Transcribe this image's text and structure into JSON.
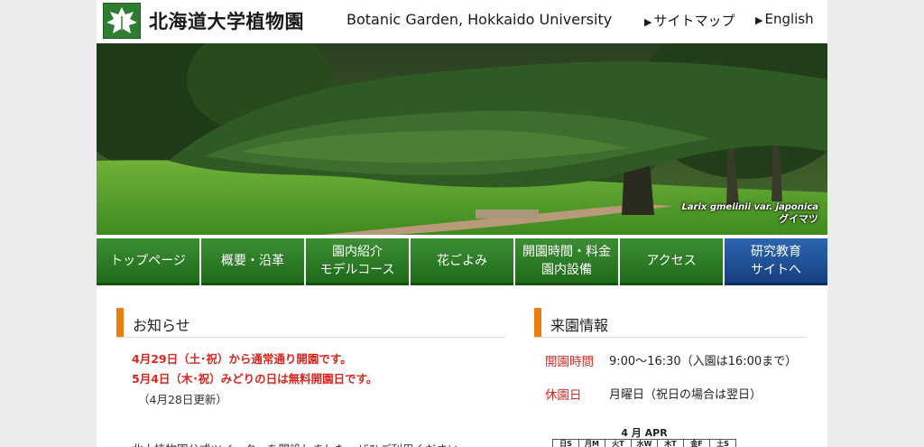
{
  "header": {
    "logo_icon": "leaf-logo-icon",
    "title_ja": "北海道大学植物園",
    "title_en": "Botanic Garden, Hokkaido University",
    "links": [
      {
        "label": "サイトマップ",
        "icon": "triangle-right-icon"
      },
      {
        "label": "English",
        "icon": "triangle-right-icon"
      }
    ]
  },
  "hero": {
    "caption_latin": "Larix gmelinii var. japonica",
    "caption_ja": "グイマツ"
  },
  "nav": [
    {
      "line1": "トップページ",
      "line2": ""
    },
    {
      "line1": "概要・沿革",
      "line2": ""
    },
    {
      "line1": "園内紹介",
      "line2": "モデルコース"
    },
    {
      "line1": "花ごよみ",
      "line2": ""
    },
    {
      "line1": "開園時間・料金",
      "line2": "園内設備"
    },
    {
      "line1": "アクセス",
      "line2": ""
    },
    {
      "line1": "研究教育",
      "line2": "サイトへ"
    }
  ],
  "news": {
    "title": "お知らせ",
    "items": [
      "4月29日（土･祝）から通常通り開園です。",
      "5月4日（木･祝）みどりの日は無料開園日です。"
    ],
    "updated": "（4月28日更新）",
    "more": "北大植物園公式ツイッターを開設しました。ぜひご利用ください。"
  },
  "info": {
    "title": "来園情報",
    "hours_label": "開園時間",
    "hours_value": "9:00～16:30（入園は16:00まで）",
    "closed_label": "休園日",
    "closed_value": "月曜日（祝日の場合は翌日）"
  },
  "calendar": {
    "title": "4 月 APR",
    "weekdays": [
      "日S",
      "月M",
      "火T",
      "水W",
      "木T",
      "金F",
      "土S"
    ]
  },
  "colors": {
    "accent_orange": "#ee7d11",
    "nav_green": "#1e6b1a",
    "nav_blue": "#163f80",
    "notice_red": "#d8261f"
  }
}
